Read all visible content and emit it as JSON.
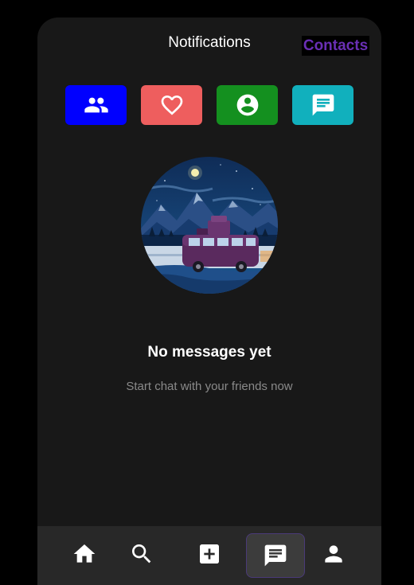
{
  "header": {
    "title": "Notifications",
    "contacts_label": "Contacts"
  },
  "quick_actions": [
    {
      "icon": "people-icon",
      "color": "#0000ff"
    },
    {
      "icon": "heart-icon",
      "color": "#ee5e5e"
    },
    {
      "icon": "account-circle-icon",
      "color": "#14901f"
    },
    {
      "icon": "chat-icon",
      "color": "#11b0bd"
    }
  ],
  "empty_state": {
    "illustration": "van-mountain-night-illustration",
    "title": "No messages yet",
    "subtitle": "Start chat with your friends now"
  },
  "bottom_nav": {
    "items": [
      {
        "icon": "home-icon",
        "active": false
      },
      {
        "icon": "search-icon",
        "active": false
      },
      {
        "icon": "add-box-icon",
        "active": false
      },
      {
        "icon": "chat-icon",
        "active": true
      },
      {
        "icon": "person-icon",
        "active": false
      }
    ]
  }
}
